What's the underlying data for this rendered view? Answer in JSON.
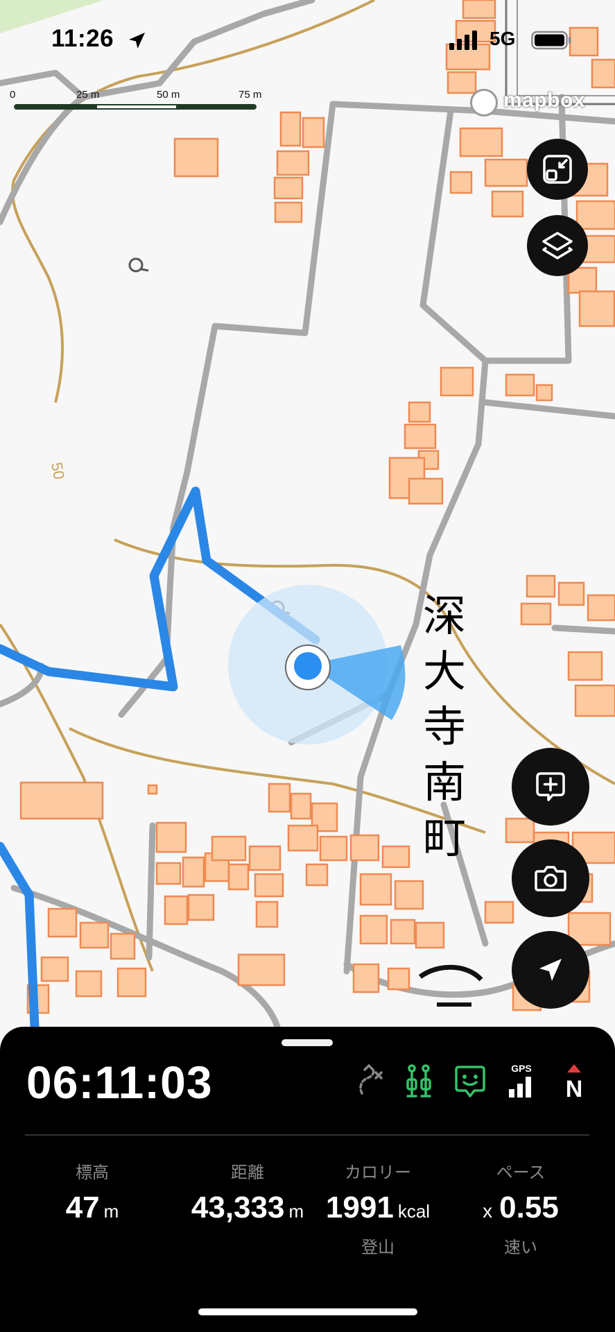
{
  "status_bar": {
    "time": "11:26",
    "network": "5G"
  },
  "scale": {
    "labels": [
      "0",
      "25 m",
      "50 m",
      "75 m"
    ]
  },
  "map": {
    "attribution": "mapbox",
    "place_label": [
      "深",
      "大",
      "寺",
      "南",
      "町"
    ],
    "contour_label": "50",
    "buttons": [
      "fullscreen",
      "layers",
      "zoom-in",
      "camera",
      "locate"
    ]
  },
  "panel": {
    "elapsed_time": "06:11:03",
    "gps_label": "GPS",
    "north_label": "N",
    "stats": {
      "elevation": {
        "label": "標高",
        "value": "47",
        "unit": "m"
      },
      "distance": {
        "label": "距離",
        "value": "43,333",
        "unit": "m"
      },
      "calories": {
        "label": "カロリー",
        "value": "1991",
        "unit": "kcal",
        "sub": "登山"
      },
      "pace": {
        "label": "ペース",
        "prefix": "x",
        "value": "0.55",
        "sub": "速い"
      }
    }
  },
  "colors": {
    "route": "#2a87e6",
    "building": "#fcc9a0",
    "building_border": "#ee8a52",
    "road": "#a8a8a8",
    "contour": "#c7a15a",
    "gps_green": "#35c26a"
  }
}
